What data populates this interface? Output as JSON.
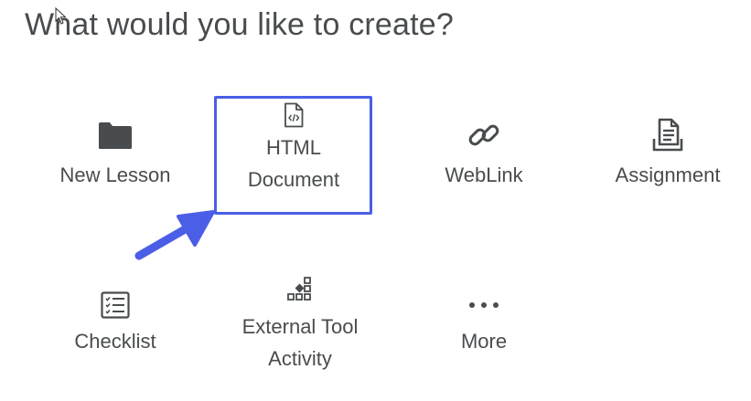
{
  "heading": "What would you like to create?",
  "tiles": [
    {
      "label": "New Lesson"
    },
    {
      "label": "HTML Document"
    },
    {
      "label": "WebLink"
    },
    {
      "label": "Assignment"
    },
    {
      "label": "Checklist"
    },
    {
      "label": "External Tool Activity"
    },
    {
      "label": "More"
    }
  ],
  "colors": {
    "text": "#494c4e",
    "icon": "#494c4e",
    "highlight": "#4a5fe6"
  }
}
